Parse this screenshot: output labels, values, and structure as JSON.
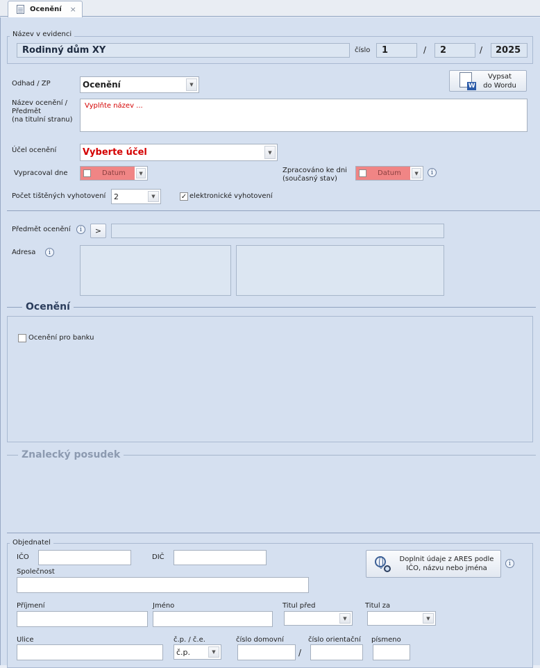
{
  "tab": {
    "label": "Ocenění",
    "close": "×"
  },
  "evidence": {
    "legend": "Název v evidenci",
    "name": "Rodinný dům XY",
    "number_label": "číslo",
    "num1": "1",
    "num2": "2",
    "year": "2025",
    "separator": "/"
  },
  "odhad": {
    "label": "Odhad / ZP",
    "value": "Ocenění"
  },
  "word_button": {
    "line1": "Vypsat",
    "line2": "do Wordu"
  },
  "nazev": {
    "label1": "Název ocenění /",
    "label2": "Předmět",
    "label3": "(na titulní stranu)",
    "placeholder": "Vyplňte název ..."
  },
  "ucel": {
    "label": "Účel ocenění",
    "value": "Vyberte účel"
  },
  "vypracoval": {
    "label": "Vypracoval dne",
    "value": "Datum"
  },
  "zpracovano": {
    "label1": "Zpracováno ke dni",
    "label2": "(současný stav)",
    "value": "Datum"
  },
  "pocet": {
    "label": "Počet tištěných vyhotovení",
    "value": "2"
  },
  "elektronicke": {
    "label": "elektronické vyhotovení",
    "mark": "✓"
  },
  "predmet": {
    "label": "Předmět ocenění",
    "button": ">"
  },
  "adresa": {
    "label": "Adresa"
  },
  "info_glyph": "i",
  "oceneni_section": {
    "title": "Ocenění",
    "banka_label": "Ocenění pro banku"
  },
  "posudek_section": {
    "title": "Znalecký posudek"
  },
  "objednatel": {
    "legend": "Objednatel",
    "ico": "IČO",
    "dic": "DIČ",
    "spolecnost": "Společnost",
    "ares_line1": "Doplnit údaje z ARES podle",
    "ares_line2": "IČO, názvu nebo jména",
    "prijmeni": "Příjmení",
    "jmeno": "Jméno",
    "titul_pred": "Titul před",
    "titul_za": "Titul za",
    "ulice": "Ulice",
    "cp_ce": "č.p. / č.e.",
    "cp_value": "č.p.",
    "cislo_domovni": "číslo domovní",
    "slash": "/",
    "cislo_orientacni": "číslo orientační",
    "pismeno": "písmeno"
  },
  "colors": {
    "background": "#d5e0f0",
    "required_red": "#d40000",
    "date_red": "#f08585"
  },
  "icons": [
    "document-icon",
    "close-icon",
    "word-icon",
    "info-icon",
    "globe-search-icon",
    "chevron-down-icon",
    "checkbox-icon"
  ]
}
